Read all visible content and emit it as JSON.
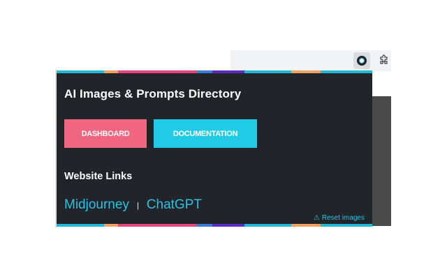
{
  "colors": {
    "popup_bg": "#212429",
    "pink": "#f0667f",
    "cyan": "#21cbe6",
    "link": "#29c3e4",
    "stripe": [
      "#21b9d6",
      "#f4a261",
      "#e8437a",
      "#3a7bd5",
      "#5b2bc4",
      "#21b9d6",
      "#f4a261",
      "#21b9d6"
    ]
  },
  "browser": {
    "extension_icon": "ai-prompts-extension-icon",
    "extensions_icon": "puzzle-icon"
  },
  "popup": {
    "title": "AI Images & Prompts Directory",
    "buttons": {
      "dashboard": "DASHBOARD",
      "documentation": "DOCUMENTATION"
    },
    "links_heading": "Website Links",
    "links": [
      {
        "label": "Midjourney"
      },
      {
        "label": "ChatGPT"
      }
    ],
    "separator": "|",
    "reset": {
      "icon": "warning-icon",
      "icon_glyph": "⚠",
      "label": "Reset images"
    }
  }
}
